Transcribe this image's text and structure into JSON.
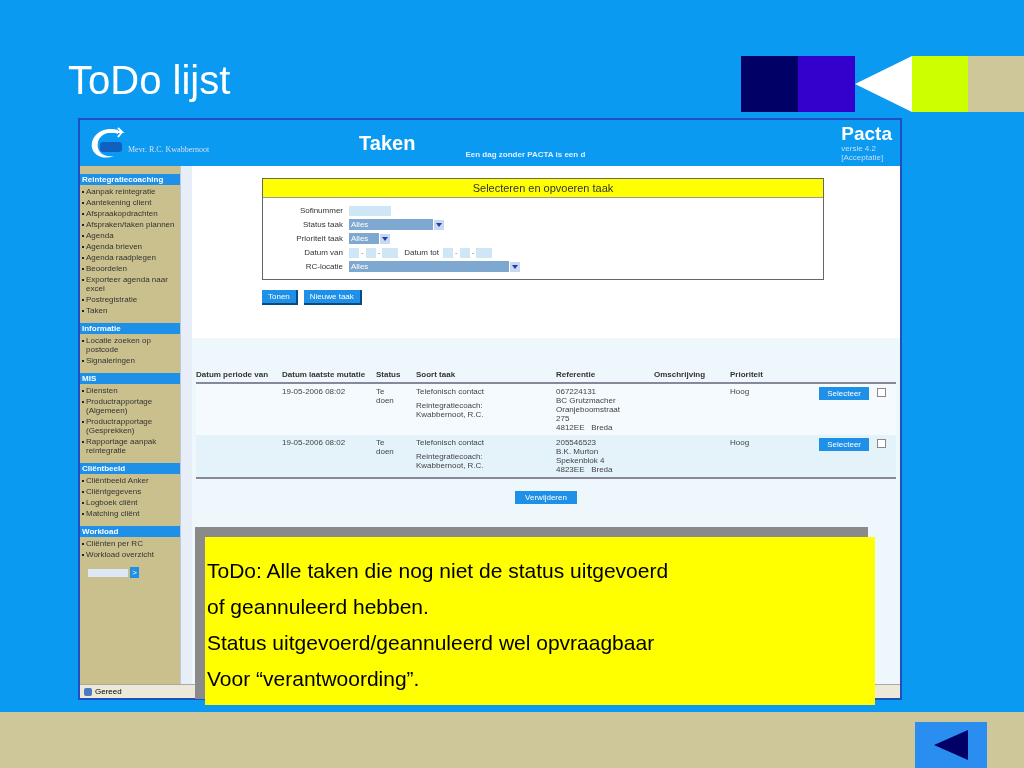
{
  "slide": {
    "title": "ToDo lijst"
  },
  "app": {
    "user": "Mevr. R.C. Kwabbernoot",
    "page_title": "Taken",
    "slogan": "Een dag zonder PACTA is een d",
    "brand": "Pacta",
    "version": "versie 4.2",
    "environment": "[Acceptatie]"
  },
  "sidebar": {
    "sections": [
      {
        "title": "Reintegratiecoaching",
        "items": [
          "Aanpak reintegratie",
          "Aantekening client",
          "Afspraakopdrachten",
          "Afspraken/taken plannen",
          "Agenda",
          "Agenda brieven",
          "Agenda raadplegen",
          "Beoordelen",
          "Exporteer agenda naar excel",
          "Postregistratie",
          "Taken"
        ]
      },
      {
        "title": "Informatie",
        "items": [
          "Locatie zoeken op postcode",
          "Signaleringen"
        ]
      },
      {
        "title": "MIS",
        "items": [
          "Diensten",
          "Productrapportage (Algemeen)",
          "Productrapportage (Gesprekken)",
          "Rapportage aanpak reintegratie"
        ]
      },
      {
        "title": "Cliëntbeeld",
        "items": [
          "Cliëntbeeld Anker",
          "Cliëntgegevens",
          "Logboek cliënt",
          "Matching cliënt"
        ]
      },
      {
        "title": "Workload",
        "items": [
          "Cliënten per RC",
          "Workload overzicht"
        ]
      }
    ],
    "go_button": ">"
  },
  "form": {
    "title": "Selecteren en opvoeren taak",
    "fields": [
      {
        "kind": "text",
        "label": "Sofinummer"
      },
      {
        "kind": "select",
        "label": "Status taak",
        "value": "Alles"
      },
      {
        "kind": "short-select",
        "label": "Prioriteit taak",
        "value": "Alles"
      },
      {
        "kind": "date-range",
        "label": "Datum van",
        "second_label": "Datum tot",
        "separator": "-"
      },
      {
        "kind": "long-select",
        "label": "RC-locatie",
        "value": "Alles"
      }
    ],
    "buttons": [
      "Tonen",
      "Nieuwe taak"
    ]
  },
  "table": {
    "columns": [
      "Datum periode van",
      "Datum laatste mutatie",
      "Status",
      "Soort taak",
      "Referentie",
      "Omschrijving",
      "Prioriteit"
    ],
    "rows": [
      {
        "mutatie": "19-05-2006 08:02",
        "status": "Te doen",
        "soort": "Telefonisch contact",
        "coach": "Reintegratiecoach: Kwabbernoot, R.C.",
        "referentie": [
          "067224131",
          "BC Grutzmacher",
          "Oranjeboomstraat",
          "275",
          "4812EE   Breda"
        ],
        "prioriteit": "Hoog",
        "button": "Selecteer",
        "checked": false
      },
      {
        "mutatie": "19-05-2006 08:02",
        "status": "Te doen",
        "soort": "Telefonisch contact",
        "coach": "Reintegratiecoach: Kwabbernoot, R.C.",
        "referentie": [
          "205546523",
          "B.K. Murton",
          "Spekenblok 4",
          "4823EE   Breda"
        ],
        "prioriteit": "Hoog",
        "button": "Selecteer",
        "checked": false
      }
    ],
    "delete_button": "Verwijderen"
  },
  "status_bar": "Gereed",
  "note": [
    "ToDo: Alle taken die nog niet de status uitgevoerd",
    "of geannuleerd hebben.",
    "Status uitgevoerd/geannuleerd wel opvraagbaar",
    "Voor “verantwoording”."
  ]
}
